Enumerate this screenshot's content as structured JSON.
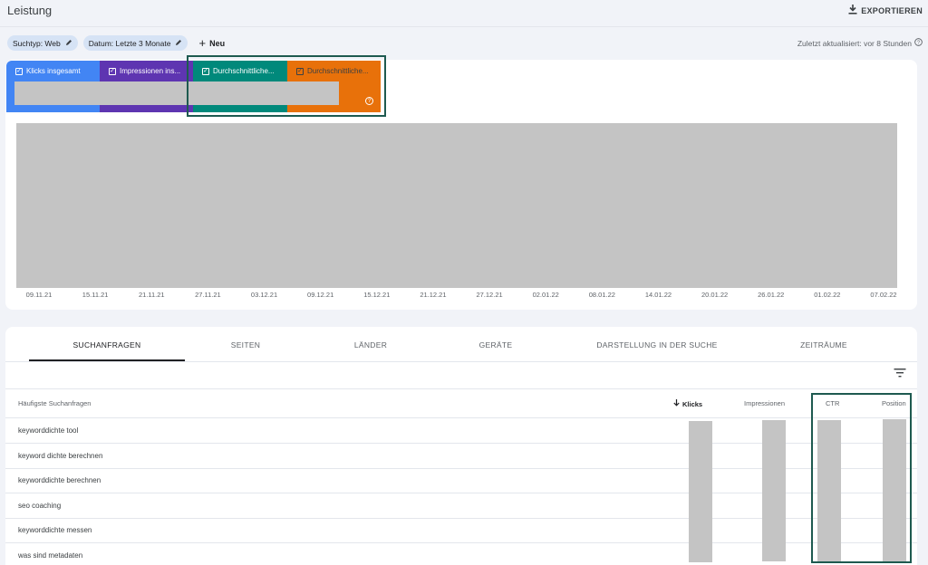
{
  "header": {
    "title": "Leistung",
    "export_label": "EXPORTIEREN"
  },
  "filters": {
    "search_type": "Suchtyp: Web",
    "date": "Datum: Letzte 3 Monate",
    "new_label": "Neu",
    "last_updated": "Zuletzt aktualisiert: vor 8 Stunden"
  },
  "metrics": [
    {
      "label": "Klicks insgesamt",
      "color": "#4285f4"
    },
    {
      "label": "Impressionen ins...",
      "color": "#5e35b1"
    },
    {
      "label": "Durchschnittliche...",
      "color": "#00897b"
    },
    {
      "label": "Durchschnittliche...",
      "color": "#e8710a"
    }
  ],
  "chart": {
    "x_labels": [
      "09.11.21",
      "15.11.21",
      "21.11.21",
      "27.11.21",
      "03.12.21",
      "09.12.21",
      "15.12.21",
      "21.12.21",
      "27.12.21",
      "02.01.22",
      "08.01.22",
      "14.01.22",
      "20.01.22",
      "26.01.22",
      "01.02.22",
      "07.02.22"
    ]
  },
  "tabs": [
    {
      "label": "SUCHANFRAGEN",
      "active": true
    },
    {
      "label": "SEITEN",
      "active": false
    },
    {
      "label": "LÄNDER",
      "active": false
    },
    {
      "label": "GERÄTE",
      "active": false
    },
    {
      "label": "DARSTELLUNG IN DER SUCHE",
      "active": false
    },
    {
      "label": "ZEITRÄUME",
      "active": false
    }
  ],
  "table": {
    "columns": {
      "query": "Häufigste Suchanfragen",
      "clicks": "Klicks",
      "impressions": "Impressionen",
      "ctr": "CTR",
      "position": "Position"
    },
    "rows": [
      "keyworddichte tool",
      "keyword dichte berechnen",
      "keyworddichte berechnen",
      "seo coaching",
      "keyworddichte messen",
      "was sind metadaten"
    ]
  }
}
